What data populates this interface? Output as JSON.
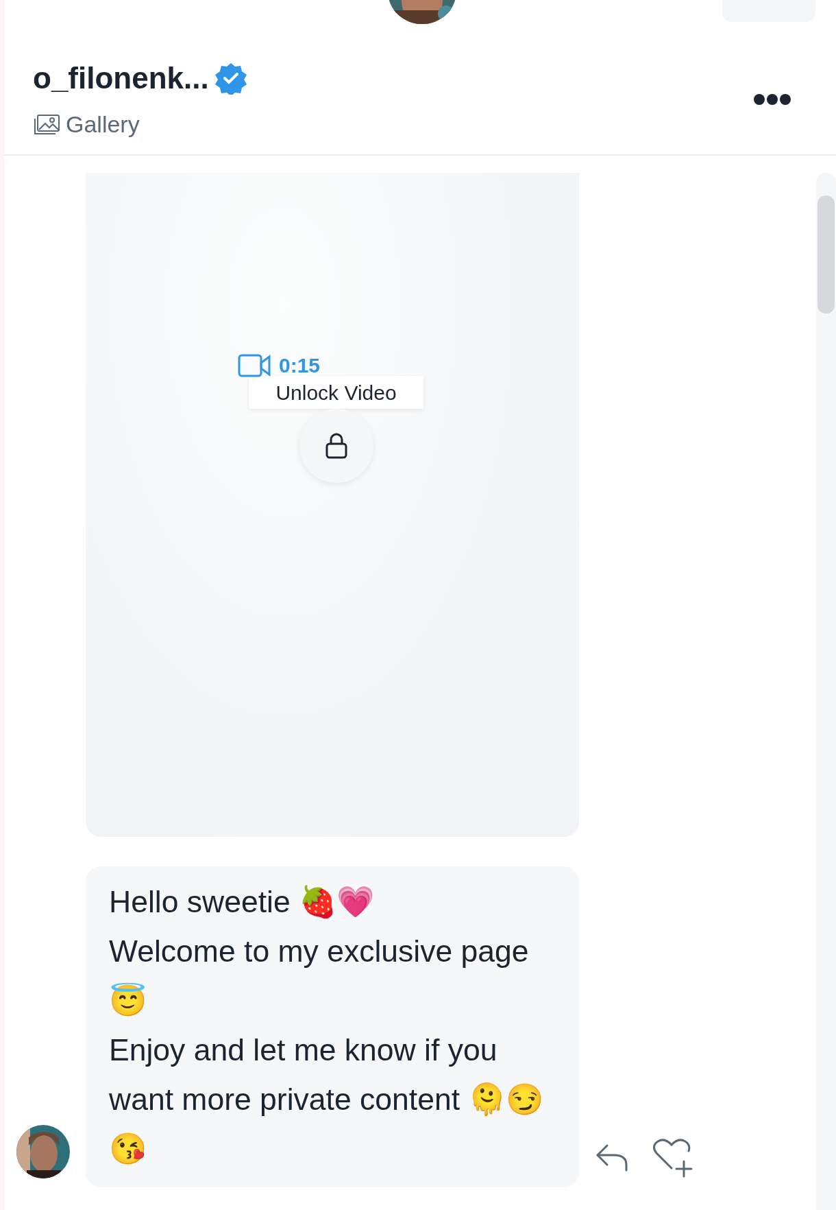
{
  "header": {
    "name": "o_filonenk...",
    "verified": true,
    "subtitle": "Gallery"
  },
  "video": {
    "duration": "0:15",
    "action": "Unlock Video",
    "locked": true
  },
  "message": {
    "lines": [
      "Hello sweetie 🍓💗",
      "Welcome to my exclusive page 😇",
      "Enjoy and let me know if you want more private content 🫠😏😘"
    ]
  }
}
